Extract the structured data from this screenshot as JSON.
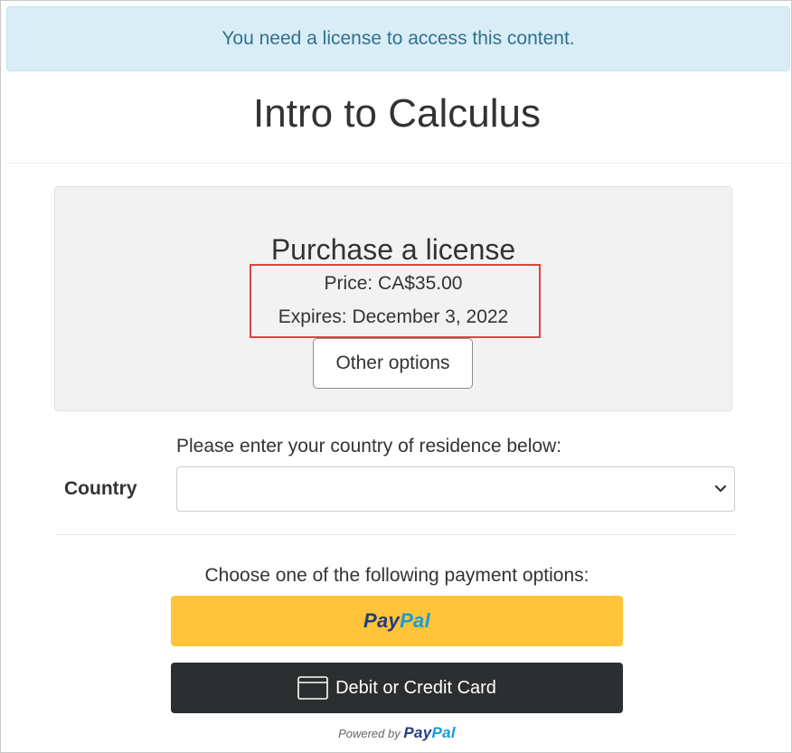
{
  "alert": {
    "message": "You need a license to access this content."
  },
  "course": {
    "title": "Intro to Calculus"
  },
  "license": {
    "heading": "Purchase a license",
    "price": "Price: CA$35.00",
    "expires": "Expires: December 3, 2022",
    "other_options_label": "Other options"
  },
  "country": {
    "prompt": "Please enter your country of residence below:",
    "label": "Country",
    "selected_value": ""
  },
  "payment": {
    "prompt": "Choose one of the following payment options:",
    "paypal_logo_pay": "Pay",
    "paypal_logo_pal": "Pal",
    "card_label": "Debit or Credit Card",
    "powered_by": "Powered by",
    "powered_logo_pay": "Pay",
    "powered_logo_pal": "Pal",
    "colors": {
      "paypal_button": "#ffc439",
      "card_button": "#2c2e2f",
      "paypal_dark_blue": "#253b80",
      "paypal_light_blue": "#179bd7"
    }
  },
  "highlight": {
    "color": "#e04141"
  },
  "icons": {
    "select_chevron": "chevron-down-icon",
    "card": "credit-card-icon"
  }
}
